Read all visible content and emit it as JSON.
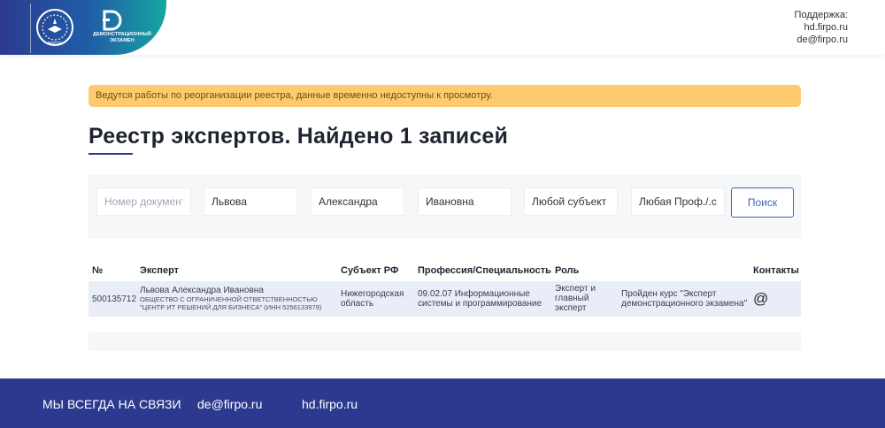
{
  "header": {
    "logo_caption": "ДЕМОНСТРАЦИОННЫЙ ЭКЗАМЕН",
    "emblem_text": "ФИРПО",
    "support_label": "Поддержка:",
    "support_links": [
      "hd.firpo.ru",
      "de@firpo.ru"
    ]
  },
  "alert": {
    "text": "Ведутся работы по реорганизации реестра, данные временно недоступны к просмотру.",
    "color": "#fdcb6e"
  },
  "page": {
    "title": "Реестр экспертов. Найдено 1 записей"
  },
  "search": {
    "document_placeholder": "Номер документа",
    "document_value": "",
    "last_name": "Львова",
    "first_name": "Александра",
    "middle_name": "Ивановна",
    "region_value": "Любой субъект РФ",
    "profession_value": "Любая Проф./.спец",
    "button_label": "Поиск"
  },
  "table": {
    "columns": [
      "№",
      "Эксперт",
      "Субъект РФ",
      "Профессия/Специальность",
      "Роль",
      "Контакты"
    ],
    "rows": [
      {
        "number": "500135712",
        "name": "Львова Александра Ивановна",
        "org_line1": "ОБЩЕСТВО С ОГРАНИЧЕННОЙ ОТВЕТСТВЕННОСТЬЮ",
        "org_line2": "\"ЦЕНТР ИТ РЕШЕНИЙ ДЛЯ БИЗНЕСА\" (ИНН 5256133979)",
        "region_line1": "Нижегородская",
        "region_line2": "область",
        "profession_line1": "09.02.07 Информационные",
        "profession_line2": "системы и программирование",
        "role_line1": "Эксперт и",
        "role_line2": "главный",
        "role_line3": "эксперт",
        "course_line1": "Пройден курс \"Эксперт",
        "course_line2": "демонстрационного экзамена\"",
        "contact_icon": "at-sign-icon",
        "contact_glyph": "@"
      }
    ]
  },
  "footer": {
    "slogan": "МЫ ВСЕГДА НА СВЯЗИ",
    "email": "de@firpo.ru",
    "site": "hd.firpo.ru",
    "background": "#2b3a8f"
  }
}
